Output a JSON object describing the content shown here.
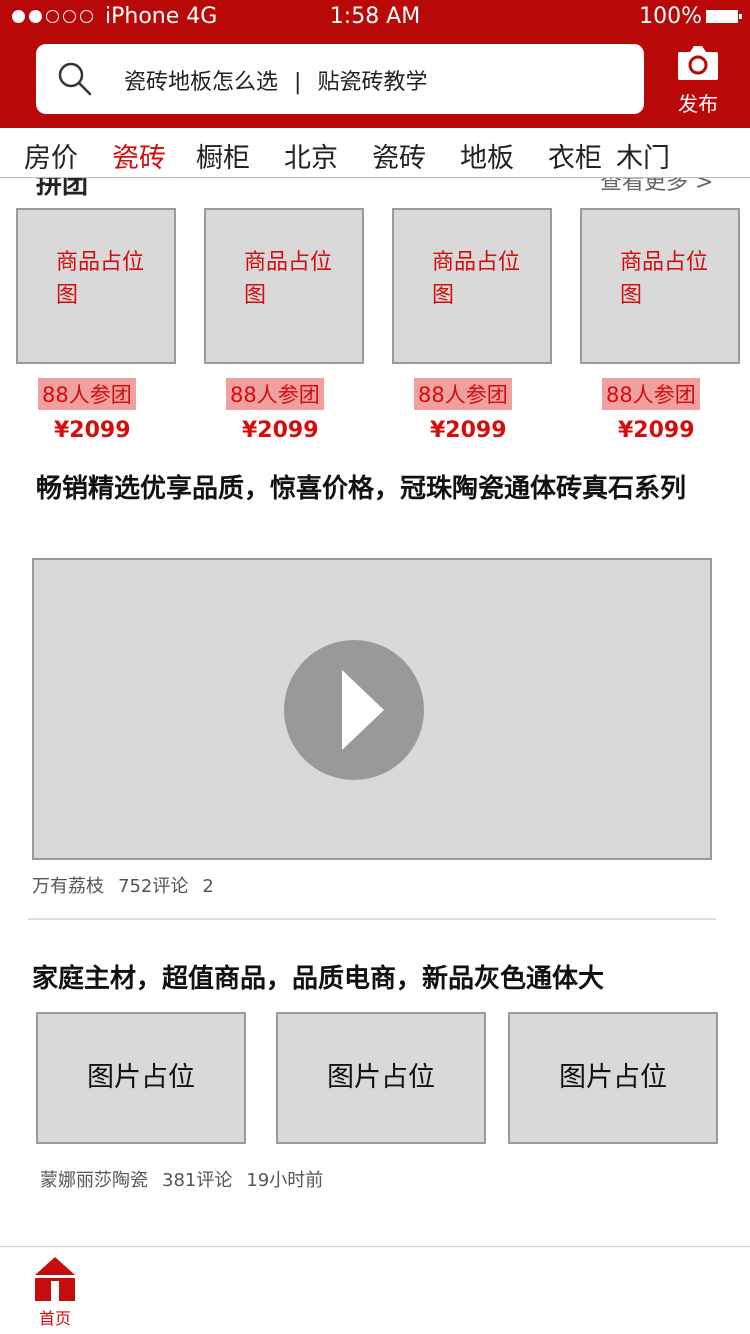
{
  "status_bar": {
    "carrier": "iPhone 4G",
    "time": "1:58 AM",
    "battery": "100%"
  },
  "search": {
    "text_left": "瓷砖地板怎么选",
    "separator": "|",
    "text_right": "贴瓷砖教学"
  },
  "publish": {
    "label": "发布"
  },
  "categories": [
    {
      "label": "房价"
    },
    {
      "label": "瓷砖",
      "active": true
    },
    {
      "label": "橱柜"
    },
    {
      "label": "北京"
    },
    {
      "label": "瓷砖"
    },
    {
      "label": "地板"
    },
    {
      "label": "衣柜"
    },
    {
      "label": "木门"
    }
  ],
  "group_buy": {
    "title": "拼团",
    "more": "查看更多 >",
    "products": [
      {
        "thumb": "商品占位图",
        "participants": "88人参团",
        "price": "¥2099"
      },
      {
        "thumb": "商品占位图",
        "participants": "88人参团",
        "price": "¥2099"
      },
      {
        "thumb": "商品占位图",
        "participants": "88人参团",
        "price": "¥2099"
      },
      {
        "thumb": "商品占位图",
        "participants": "88人参团",
        "price": "¥2099"
      }
    ]
  },
  "article1": {
    "title": "畅销精选优享品质，惊喜价格，冠珠陶瓷通体砖真石系列",
    "author": "万有荔枝",
    "comments": "752评论",
    "extra": "2"
  },
  "article2": {
    "title": "家庭主材，超值商品，品质电商，新品灰色通体大",
    "images": [
      {
        "label": "图片占位"
      },
      {
        "label": "图片占位"
      },
      {
        "label": "图片占位"
      }
    ],
    "author": "蒙娜丽莎陶瓷",
    "comments": "381评论",
    "time": "19小时前"
  },
  "tabbar": {
    "home_label": "首页"
  },
  "colors": {
    "brand_red": "#b90808",
    "accent_red": "#d40d0d",
    "placeholder_gray": "#d9d9d9"
  }
}
